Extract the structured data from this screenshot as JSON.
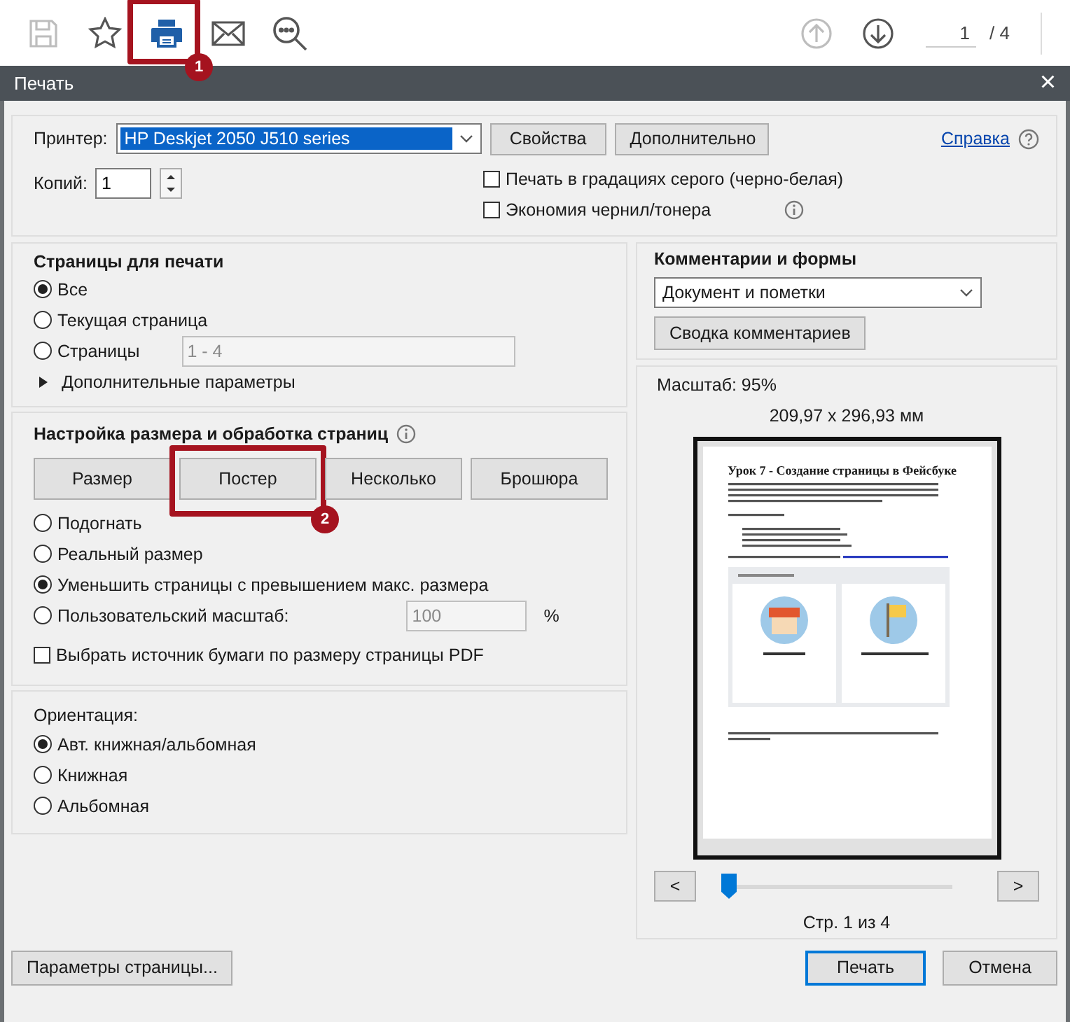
{
  "toolbar": {
    "tools": [
      {
        "kind": "save",
        "disabled": true
      },
      {
        "kind": "star",
        "disabled": false
      },
      {
        "kind": "print",
        "disabled": false,
        "callout": "1"
      },
      {
        "kind": "mail",
        "disabled": false
      },
      {
        "kind": "find",
        "disabled": false
      }
    ],
    "nav": [
      {
        "kind": "up",
        "disabled": true
      },
      {
        "kind": "down",
        "disabled": false
      }
    ],
    "page_field": {
      "value": "1"
    },
    "page_total": "/ 4"
  },
  "dialog": {
    "title": "Печать",
    "close": "×"
  },
  "printer": {
    "label": "Принтер:",
    "value": "HP Deskjet 2050 J510 series",
    "buttons": [
      "Свойства",
      "Дополнительно"
    ],
    "help_link": "Справка"
  },
  "copies": {
    "label": "Копий:",
    "value": "1"
  },
  "options": [
    {
      "label": "Печать в градациях серого (черно-белая)",
      "checked": false,
      "info": false
    },
    {
      "label": "Экономия чернил/тонера",
      "checked": false,
      "info": true
    }
  ],
  "pages": {
    "title": "Страницы для печати",
    "items": [
      {
        "label": "Все",
        "selected": true
      },
      {
        "label": "Текущая страница",
        "selected": false
      },
      {
        "label": "Страницы",
        "selected": false,
        "field": "1 - 4"
      }
    ],
    "more": "Дополнительные параметры"
  },
  "sizing": {
    "title": "Настройка размера и обработка страниц",
    "modes": [
      {
        "label": "Размер",
        "selected": false
      },
      {
        "label": "Постер",
        "selected": false,
        "callout": "2"
      },
      {
        "label": "Несколько",
        "selected": false
      },
      {
        "label": "Брошюра",
        "selected": false
      }
    ],
    "items": [
      {
        "label": "Подогнать",
        "selected": false
      },
      {
        "label": "Реальный размер",
        "selected": false
      },
      {
        "label": "Уменьшить страницы с превышением макс. размера",
        "selected": true
      },
      {
        "label": "Пользовательский масштаб:",
        "selected": false,
        "field": "100",
        "unit": "%"
      }
    ],
    "paper_source": {
      "label": "Выбрать источник бумаги по размеру страницы PDF",
      "checked": false
    }
  },
  "orientation": {
    "title": "Ориентация:",
    "items": [
      {
        "label": "Авт. книжная/альбомная",
        "selected": true
      },
      {
        "label": "Книжная",
        "selected": false
      },
      {
        "label": "Альбомная",
        "selected": false
      }
    ]
  },
  "comments": {
    "title": "Комментарии и формы",
    "value": "Документ и пометки",
    "button": "Сводка комментариев"
  },
  "preview": {
    "scale": "Масштаб:  95%",
    "size": "209,97 x 296,93 мм",
    "doc_title": "Урок 7 - Создание страницы в Фейсбуке",
    "prev": "<",
    "next": ">",
    "level": 0,
    "page_label": "Стр. 1 из 4"
  },
  "footer": {
    "page_setup": "Параметры страницы...",
    "buttons": [
      {
        "label": "Печать",
        "default": true
      },
      {
        "label": "Отмена",
        "default": false
      }
    ]
  }
}
